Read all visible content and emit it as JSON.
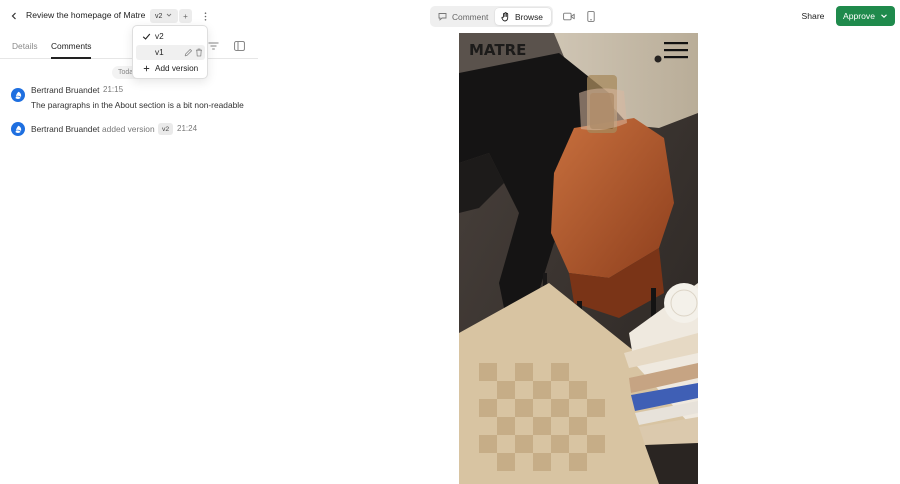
{
  "header": {
    "title": "Review the homepage of Matre",
    "version": "v2",
    "add_version_symbol": "+",
    "modes": {
      "comment": "Comment",
      "browse": "Browse"
    },
    "share": "Share",
    "approve": "Approve"
  },
  "panel": {
    "tabs": {
      "details": "Details",
      "comments": "Comments"
    },
    "date_chip": "Today"
  },
  "version_menu": {
    "items": [
      {
        "label": "v2",
        "selected": true
      },
      {
        "label": "v1",
        "selected": false
      }
    ],
    "add_label": "Add version"
  },
  "comments": [
    {
      "author": "Bertrand Bruandet",
      "time": "21:15",
      "text": "The paragraphs in the About section is a bit non-readable"
    }
  ],
  "activity": [
    {
      "author": "Bertrand Bruandet",
      "action": "added version",
      "version": "v2",
      "time": "21:24"
    }
  ],
  "preview": {
    "brand": "MATRE"
  },
  "colors": {
    "approve": "#1f8a4c",
    "avatar": "#1e6fe0",
    "sofa": "#b85a2c"
  }
}
